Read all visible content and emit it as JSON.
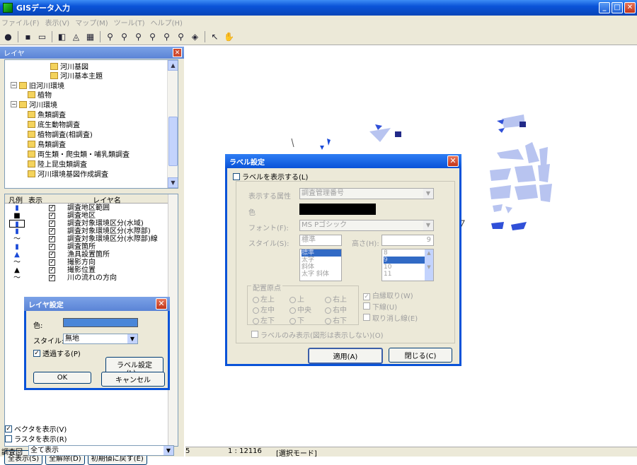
{
  "window": {
    "title": "GISデータ入力",
    "minimize": "_",
    "maximize": "□",
    "close": "✕"
  },
  "menu": [
    "ファイル(F)",
    "表示(V)",
    "マップ(M)",
    "ツール(T)",
    "ヘルプ(H)"
  ],
  "toolbar_icons": [
    "globe-icon",
    "save-icon",
    "print-icon",
    "layers-icon",
    "lock-icon",
    "table-icon",
    "zoom-in-icon",
    "zoom-out-icon",
    "zoom-box-in-icon",
    "zoom-box-out-icon",
    "zoom-prev-icon",
    "zoom-next-icon",
    "full-extent-icon",
    "select-arrow-icon",
    "pan-hand-icon"
  ],
  "layer_panel": {
    "title": "レイヤ",
    "close": "✕",
    "tree": [
      {
        "label": "河川基図",
        "indent": 4
      },
      {
        "label": "河川基本主題",
        "indent": 4
      },
      {
        "label": "旧河川環境",
        "indent": 0,
        "expander": "−"
      },
      {
        "label": "植物",
        "indent": 2
      },
      {
        "label": "河川環境",
        "indent": 0,
        "expander": "−"
      },
      {
        "label": "魚類調査",
        "indent": 2
      },
      {
        "label": "底生動物調査",
        "indent": 2
      },
      {
        "label": "植物調査(相調査)",
        "indent": 2
      },
      {
        "label": "鳥類調査",
        "indent": 2
      },
      {
        "label": "両生類・爬虫類・哺乳類調査",
        "indent": 2
      },
      {
        "label": "陸上昆虫類調査",
        "indent": 2
      },
      {
        "label": "河川環境基図作成調査",
        "indent": 2
      }
    ],
    "layer_headers": {
      "legend": "凡例",
      "visible": "表示",
      "name": "レイヤ名"
    },
    "layers": [
      {
        "symbol": "▮",
        "checked": "✓",
        "name": "調査地区範囲"
      },
      {
        "symbol": "■",
        "checked": "✓",
        "name": "調査地区"
      },
      {
        "symbol": "▮",
        "checked": "✓",
        "name": "調査対象環境区分(水域)"
      },
      {
        "symbol": "▮",
        "checked": "✓",
        "name": "調査対象環境区分(水際部)"
      },
      {
        "symbol": "〜",
        "checked": "✓",
        "name": "調査対象環境区分(水際部)線"
      },
      {
        "symbol": "▮",
        "checked": "✓",
        "name": "調査箇所"
      },
      {
        "symbol": "▲",
        "checked": "✓",
        "name": "漁具設置箇所"
      },
      {
        "symbol": "〜",
        "checked": "✓",
        "name": "撮影方向"
      },
      {
        "symbol": "▲",
        "checked": "✓",
        "name": "撮影位置"
      },
      {
        "symbol": "〜",
        "checked": "✓",
        "name": "川の流れの方向"
      }
    ],
    "buttons": {
      "show_all": "全表示(S)",
      "clear_all": "全解除(D)",
      "reset": "初期値に戻す(E)"
    },
    "show_vector": "ベクタを表示(V)",
    "show_raster": "ラスタを表示(R)",
    "survey_label": "調査回",
    "survey_value": "全て表示"
  },
  "layer_settings_dialog": {
    "title": "レイヤ設定",
    "close": "✕",
    "color_label": "色:",
    "color_value": "#4a86d8",
    "style_label": "スタイル:",
    "style_value": "無地",
    "transparent": "透過する(P)",
    "label_button": "ラベル設定(L)...",
    "ok": "OK",
    "cancel": "キャンセル"
  },
  "label_dialog": {
    "title": "ラベル設定",
    "close": "✕",
    "show_label": "ラベルを表示する(L)",
    "attr_label": "表示する属性",
    "attr_value": "調査管理番号",
    "color_label": "色",
    "font_label": "フォント(F):",
    "font_value": "MS Pゴシック",
    "style_label": "スタイル(S):",
    "style_value": "標準",
    "height_label": "高さ(H):",
    "height_value": "9",
    "style_options": [
      "標準",
      "太字",
      "斜体",
      "太字 斜体"
    ],
    "size_options": [
      "8",
      "9",
      "10",
      "11"
    ],
    "origin_group": "配置原点",
    "origins": [
      "左上",
      "上",
      "右上",
      "左中",
      "中央",
      "右中",
      "左下",
      "下",
      "右下"
    ],
    "outline": "白縁取り(W)",
    "underline": "下線(U)",
    "strikeout": "取り消し線(E)",
    "label_only": "ラベルのみ表示(図形は表示しない)(O)",
    "apply": "適用(A)",
    "close_button": "閉じる(C)"
  },
  "status": {
    "left": "5",
    "scale": "1 : 12116",
    "mode": "[選択モード]"
  }
}
